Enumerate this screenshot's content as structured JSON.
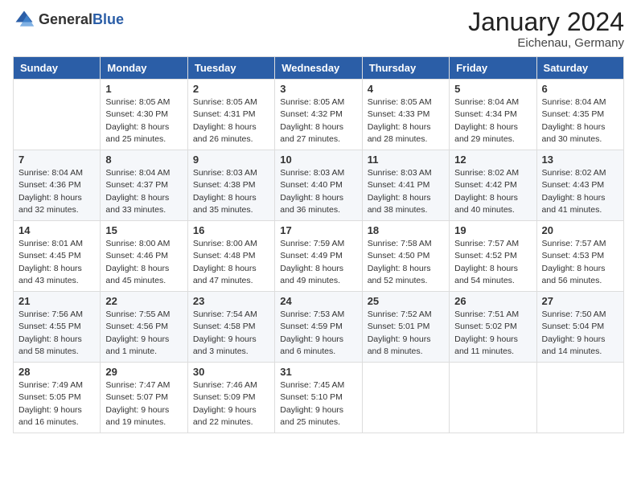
{
  "logo": {
    "general": "General",
    "blue": "Blue"
  },
  "title": {
    "month": "January 2024",
    "location": "Eichenau, Germany"
  },
  "weekdays": [
    "Sunday",
    "Monday",
    "Tuesday",
    "Wednesday",
    "Thursday",
    "Friday",
    "Saturday"
  ],
  "weeks": [
    [
      {
        "day": "",
        "info": ""
      },
      {
        "day": "1",
        "info": "Sunrise: 8:05 AM\nSunset: 4:30 PM\nDaylight: 8 hours\nand 25 minutes."
      },
      {
        "day": "2",
        "info": "Sunrise: 8:05 AM\nSunset: 4:31 PM\nDaylight: 8 hours\nand 26 minutes."
      },
      {
        "day": "3",
        "info": "Sunrise: 8:05 AM\nSunset: 4:32 PM\nDaylight: 8 hours\nand 27 minutes."
      },
      {
        "day": "4",
        "info": "Sunrise: 8:05 AM\nSunset: 4:33 PM\nDaylight: 8 hours\nand 28 minutes."
      },
      {
        "day": "5",
        "info": "Sunrise: 8:04 AM\nSunset: 4:34 PM\nDaylight: 8 hours\nand 29 minutes."
      },
      {
        "day": "6",
        "info": "Sunrise: 8:04 AM\nSunset: 4:35 PM\nDaylight: 8 hours\nand 30 minutes."
      }
    ],
    [
      {
        "day": "7",
        "info": "Sunrise: 8:04 AM\nSunset: 4:36 PM\nDaylight: 8 hours\nand 32 minutes."
      },
      {
        "day": "8",
        "info": "Sunrise: 8:04 AM\nSunset: 4:37 PM\nDaylight: 8 hours\nand 33 minutes."
      },
      {
        "day": "9",
        "info": "Sunrise: 8:03 AM\nSunset: 4:38 PM\nDaylight: 8 hours\nand 35 minutes."
      },
      {
        "day": "10",
        "info": "Sunrise: 8:03 AM\nSunset: 4:40 PM\nDaylight: 8 hours\nand 36 minutes."
      },
      {
        "day": "11",
        "info": "Sunrise: 8:03 AM\nSunset: 4:41 PM\nDaylight: 8 hours\nand 38 minutes."
      },
      {
        "day": "12",
        "info": "Sunrise: 8:02 AM\nSunset: 4:42 PM\nDaylight: 8 hours\nand 40 minutes."
      },
      {
        "day": "13",
        "info": "Sunrise: 8:02 AM\nSunset: 4:43 PM\nDaylight: 8 hours\nand 41 minutes."
      }
    ],
    [
      {
        "day": "14",
        "info": "Sunrise: 8:01 AM\nSunset: 4:45 PM\nDaylight: 8 hours\nand 43 minutes."
      },
      {
        "day": "15",
        "info": "Sunrise: 8:00 AM\nSunset: 4:46 PM\nDaylight: 8 hours\nand 45 minutes."
      },
      {
        "day": "16",
        "info": "Sunrise: 8:00 AM\nSunset: 4:48 PM\nDaylight: 8 hours\nand 47 minutes."
      },
      {
        "day": "17",
        "info": "Sunrise: 7:59 AM\nSunset: 4:49 PM\nDaylight: 8 hours\nand 49 minutes."
      },
      {
        "day": "18",
        "info": "Sunrise: 7:58 AM\nSunset: 4:50 PM\nDaylight: 8 hours\nand 52 minutes."
      },
      {
        "day": "19",
        "info": "Sunrise: 7:57 AM\nSunset: 4:52 PM\nDaylight: 8 hours\nand 54 minutes."
      },
      {
        "day": "20",
        "info": "Sunrise: 7:57 AM\nSunset: 4:53 PM\nDaylight: 8 hours\nand 56 minutes."
      }
    ],
    [
      {
        "day": "21",
        "info": "Sunrise: 7:56 AM\nSunset: 4:55 PM\nDaylight: 8 hours\nand 58 minutes."
      },
      {
        "day": "22",
        "info": "Sunrise: 7:55 AM\nSunset: 4:56 PM\nDaylight: 9 hours\nand 1 minute."
      },
      {
        "day": "23",
        "info": "Sunrise: 7:54 AM\nSunset: 4:58 PM\nDaylight: 9 hours\nand 3 minutes."
      },
      {
        "day": "24",
        "info": "Sunrise: 7:53 AM\nSunset: 4:59 PM\nDaylight: 9 hours\nand 6 minutes."
      },
      {
        "day": "25",
        "info": "Sunrise: 7:52 AM\nSunset: 5:01 PM\nDaylight: 9 hours\nand 8 minutes."
      },
      {
        "day": "26",
        "info": "Sunrise: 7:51 AM\nSunset: 5:02 PM\nDaylight: 9 hours\nand 11 minutes."
      },
      {
        "day": "27",
        "info": "Sunrise: 7:50 AM\nSunset: 5:04 PM\nDaylight: 9 hours\nand 14 minutes."
      }
    ],
    [
      {
        "day": "28",
        "info": "Sunrise: 7:49 AM\nSunset: 5:05 PM\nDaylight: 9 hours\nand 16 minutes."
      },
      {
        "day": "29",
        "info": "Sunrise: 7:47 AM\nSunset: 5:07 PM\nDaylight: 9 hours\nand 19 minutes."
      },
      {
        "day": "30",
        "info": "Sunrise: 7:46 AM\nSunset: 5:09 PM\nDaylight: 9 hours\nand 22 minutes."
      },
      {
        "day": "31",
        "info": "Sunrise: 7:45 AM\nSunset: 5:10 PM\nDaylight: 9 hours\nand 25 minutes."
      },
      {
        "day": "",
        "info": ""
      },
      {
        "day": "",
        "info": ""
      },
      {
        "day": "",
        "info": ""
      }
    ]
  ]
}
